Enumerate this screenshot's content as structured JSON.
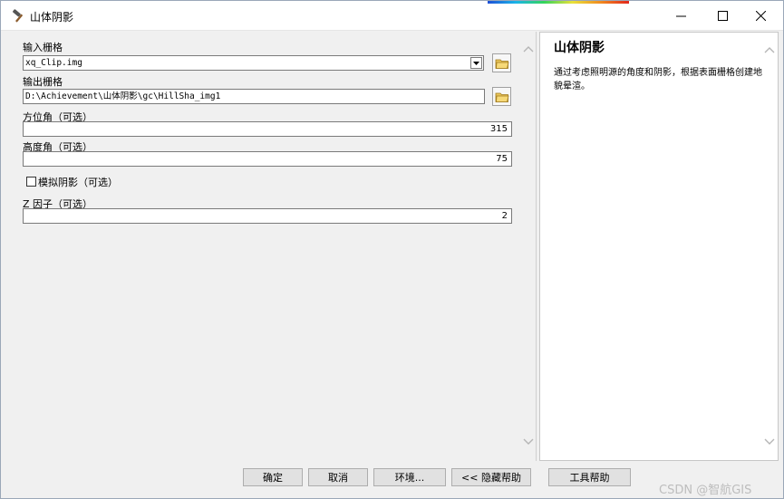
{
  "window": {
    "title": "山体阴影",
    "accent_strip_colors": [
      "#1f4fd6",
      "#19b4e8",
      "#34d45a",
      "#e8e13a",
      "#f08a1f",
      "#e2261c"
    ],
    "icon": "hammer-icon",
    "controls": [
      "minimize-icon",
      "maximize-icon",
      "close-icon"
    ]
  },
  "form": {
    "input_raster": {
      "label": "输入栅格",
      "value": "xq_Clip.img"
    },
    "output_raster": {
      "label": "输出栅格",
      "value": "D:\\Achievement\\山体阴影\\gc\\HillSha_img1"
    },
    "azimuth": {
      "label": "方位角（可选）",
      "value": "315"
    },
    "altitude": {
      "label": "高度角（可选）",
      "value": "75"
    },
    "model_shadows": {
      "label": "模拟阴影（可选）",
      "checked": false
    },
    "z_factor": {
      "label": "Z 因子（可选）",
      "value": "2"
    }
  },
  "help": {
    "title": "山体阴影",
    "text": "通过考虑照明源的角度和阴影，根据表面栅格创建地貌晕渲。"
  },
  "buttons": {
    "ok": "确定",
    "cancel": "取消",
    "environments": "环境...",
    "hide_help": "<< 隐藏帮助",
    "tool_help": "工具帮助"
  },
  "watermark": "CSDN @智航GIS"
}
